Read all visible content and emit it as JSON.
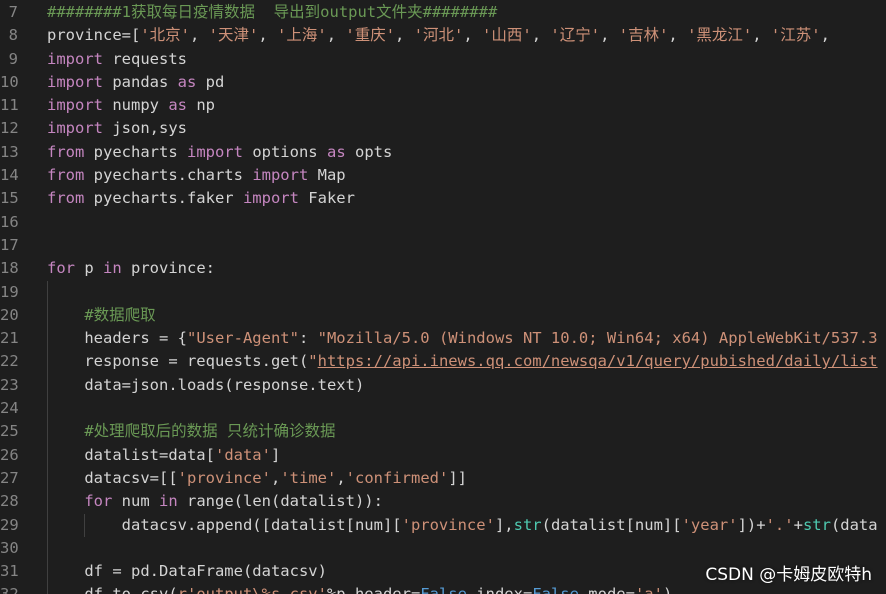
{
  "editor": {
    "lines": [
      {
        "n": "7",
        "indent": 0,
        "tokens": [
          [
            "cm",
            "########1获取每日疫情数据  导出到output文件夹########"
          ]
        ]
      },
      {
        "n": "8",
        "indent": 0,
        "tokens": [
          [
            "plain",
            "province=["
          ],
          [
            "str",
            "'北京'"
          ],
          [
            "plain",
            ", "
          ],
          [
            "str",
            "'天津'"
          ],
          [
            "plain",
            ", "
          ],
          [
            "str",
            "'上海'"
          ],
          [
            "plain",
            ", "
          ],
          [
            "str",
            "'重庆'"
          ],
          [
            "plain",
            ", "
          ],
          [
            "str",
            "'河北'"
          ],
          [
            "plain",
            ", "
          ],
          [
            "str",
            "'山西'"
          ],
          [
            "plain",
            ", "
          ],
          [
            "str",
            "'辽宁'"
          ],
          [
            "plain",
            ", "
          ],
          [
            "str",
            "'吉林'"
          ],
          [
            "plain",
            ", "
          ],
          [
            "str",
            "'黑龙江'"
          ],
          [
            "plain",
            ", "
          ],
          [
            "str",
            "'江苏'"
          ],
          [
            "plain",
            ","
          ]
        ]
      },
      {
        "n": "9",
        "indent": 0,
        "tokens": [
          [
            "kw",
            "import"
          ],
          [
            "plain",
            " requests"
          ]
        ]
      },
      {
        "n": "10",
        "indent": 0,
        "tokens": [
          [
            "kw",
            "import"
          ],
          [
            "plain",
            " pandas "
          ],
          [
            "kw",
            "as"
          ],
          [
            "plain",
            " pd"
          ]
        ]
      },
      {
        "n": "11",
        "indent": 0,
        "tokens": [
          [
            "kw",
            "import"
          ],
          [
            "plain",
            " numpy "
          ],
          [
            "kw",
            "as"
          ],
          [
            "plain",
            " np"
          ]
        ]
      },
      {
        "n": "12",
        "indent": 0,
        "tokens": [
          [
            "kw",
            "import"
          ],
          [
            "plain",
            " json,sys"
          ]
        ]
      },
      {
        "n": "13",
        "indent": 0,
        "tokens": [
          [
            "kw",
            "from"
          ],
          [
            "plain",
            " pyecharts "
          ],
          [
            "kw",
            "import"
          ],
          [
            "plain",
            " options "
          ],
          [
            "kw",
            "as"
          ],
          [
            "plain",
            " opts"
          ]
        ]
      },
      {
        "n": "14",
        "indent": 0,
        "tokens": [
          [
            "kw",
            "from"
          ],
          [
            "plain",
            " pyecharts.charts "
          ],
          [
            "kw",
            "import"
          ],
          [
            "plain",
            " Map"
          ]
        ]
      },
      {
        "n": "15",
        "indent": 0,
        "tokens": [
          [
            "kw",
            "from"
          ],
          [
            "plain",
            " pyecharts.faker "
          ],
          [
            "kw",
            "import"
          ],
          [
            "plain",
            " Faker"
          ]
        ]
      },
      {
        "n": "16",
        "indent": 0,
        "tokens": []
      },
      {
        "n": "17",
        "indent": 0,
        "tokens": []
      },
      {
        "n": "18",
        "indent": 0,
        "tokens": [
          [
            "kw",
            "for"
          ],
          [
            "plain",
            " p "
          ],
          [
            "kw",
            "in"
          ],
          [
            "plain",
            " province:"
          ]
        ]
      },
      {
        "n": "19",
        "indent": 1,
        "tokens": []
      },
      {
        "n": "20",
        "indent": 1,
        "tokens": [
          [
            "plain",
            "    "
          ],
          [
            "cm",
            "#数据爬取"
          ]
        ]
      },
      {
        "n": "21",
        "indent": 1,
        "tokens": [
          [
            "plain",
            "    headers = {"
          ],
          [
            "str",
            "\"User-Agent\""
          ],
          [
            "plain",
            ": "
          ],
          [
            "str",
            "\"Mozilla/5.0 (Windows NT 10.0; Win64; x64) AppleWebKit/537.3"
          ]
        ]
      },
      {
        "n": "22",
        "indent": 1,
        "tokens": [
          [
            "plain",
            "    response = requests.get("
          ],
          [
            "str",
            "\""
          ],
          [
            "url",
            "https://api.inews.qq.com/newsqa/v1/query/pubished/daily/list"
          ]
        ]
      },
      {
        "n": "23",
        "indent": 1,
        "tokens": [
          [
            "plain",
            "    data=json.loads(response.text)"
          ]
        ]
      },
      {
        "n": "24",
        "indent": 1,
        "tokens": []
      },
      {
        "n": "25",
        "indent": 1,
        "tokens": [
          [
            "plain",
            "    "
          ],
          [
            "cm",
            "#处理爬取后的数据 只统计确诊数据"
          ]
        ]
      },
      {
        "n": "26",
        "indent": 1,
        "tokens": [
          [
            "plain",
            "    datalist=data["
          ],
          [
            "str",
            "'data'"
          ],
          [
            "plain",
            "]"
          ]
        ]
      },
      {
        "n": "27",
        "indent": 1,
        "tokens": [
          [
            "plain",
            "    datacsv=[["
          ],
          [
            "str",
            "'province'"
          ],
          [
            "plain",
            ","
          ],
          [
            "str",
            "'time'"
          ],
          [
            "plain",
            ","
          ],
          [
            "str",
            "'confirmed'"
          ],
          [
            "plain",
            "]]"
          ]
        ]
      },
      {
        "n": "28",
        "indent": 1,
        "tokens": [
          [
            "plain",
            "    "
          ],
          [
            "kw",
            "for"
          ],
          [
            "plain",
            " num "
          ],
          [
            "kw",
            "in"
          ],
          [
            "plain",
            " range(len(datalist)):"
          ]
        ]
      },
      {
        "n": "29",
        "indent": 2,
        "tokens": [
          [
            "plain",
            "        datacsv.append([datalist[num]["
          ],
          [
            "str",
            "'province'"
          ],
          [
            "plain",
            "],"
          ],
          [
            "cls",
            "str"
          ],
          [
            "plain",
            "(datalist[num]["
          ],
          [
            "str",
            "'year'"
          ],
          [
            "plain",
            "])+"
          ],
          [
            "str",
            "'.'"
          ],
          [
            "plain",
            "+"
          ],
          [
            "cls",
            "str"
          ],
          [
            "plain",
            "(data"
          ]
        ]
      },
      {
        "n": "30",
        "indent": 1,
        "tokens": []
      },
      {
        "n": "31",
        "indent": 1,
        "tokens": [
          [
            "plain",
            "    df = pd.DataFrame(datacsv)"
          ]
        ]
      },
      {
        "n": "32",
        "indent": 1,
        "tokens": [
          [
            "plain",
            "    df.to_csv("
          ],
          [
            "str",
            "r'output\\%s.csv'"
          ],
          [
            "plain",
            "%p,header="
          ],
          [
            "kw2",
            "False"
          ],
          [
            "plain",
            ",index="
          ],
          [
            "kw2",
            "False"
          ],
          [
            "plain",
            ",mode="
          ],
          [
            "str",
            "'a'"
          ],
          [
            "plain",
            ")"
          ]
        ]
      }
    ]
  },
  "watermark": "CSDN @卡姆皮欧特h",
  "colors": {
    "background": "#1e1e1e",
    "keyword": "#c586c0",
    "string": "#ce9178",
    "comment": "#6a9955",
    "builtin": "#4ec9b0",
    "text": "#d4d4d4",
    "line_number": "#858585"
  }
}
